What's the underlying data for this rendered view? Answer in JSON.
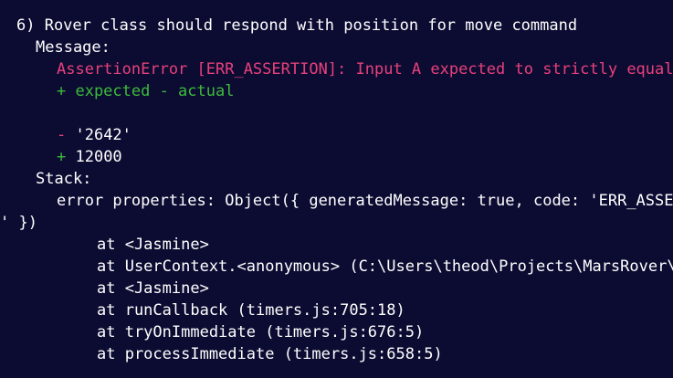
{
  "terminal": {
    "title_line": "6) Rover class should respond with position for move command",
    "message_label": "Message:",
    "assertion_error": "AssertionError [ERR_ASSERTION]: Input A expected to strictly equal input B:",
    "diff_legend": "+ expected - actual",
    "diff_minus": "- '2642'",
    "diff_plus": "+ 12000",
    "stack_label": "Stack:",
    "error_properties": "error properties: Object({ generatedMessage: true, code: 'ERR_ASSERTION', actual: '2642', expected: 12000, operator: 'strictEqual",
    "error_properties_tail": "' })",
    "stack_frames": [
      "at <Jasmine>",
      "at UserContext.<anonymous> (C:\\Users\\theod\\Projects\\MarsRover\\spec\\rover.spec.js)",
      "at <Jasmine>",
      "at runCallback (timers.js:705:18)",
      "at tryOnImmediate (timers.js:676:5)",
      "at processImmediate (timers.js:658:5)"
    ]
  },
  "colors": {
    "background": "#0c0c33",
    "text": "#ffffff",
    "error": "#e8407a",
    "success": "#3dba3a"
  }
}
